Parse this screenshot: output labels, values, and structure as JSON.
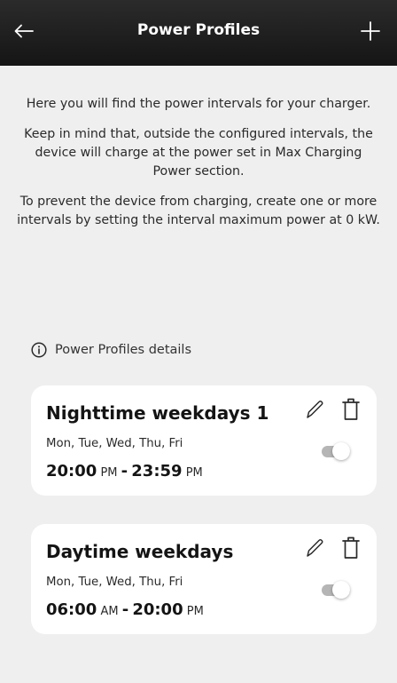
{
  "header": {
    "title": "Power Profiles",
    "back_icon": "arrow-left-icon",
    "add_icon": "plus-icon"
  },
  "intro": {
    "paragraphs": [
      "Here you will find the power intervals for your charger.",
      "Keep in mind that, outside the configured intervals, the device will charge at the power set in Max Charging Power section.",
      "To prevent the device from charging, create one or more intervals by setting the interval maximum power at 0 kW."
    ]
  },
  "details_link": {
    "label": "Power Profiles details",
    "icon": "info-icon"
  },
  "profiles": [
    {
      "name": "Nighttime weekdays 1",
      "days": "Mon, Tue, Wed, Thu, Fri",
      "start_time": "20:00",
      "start_period": "PM",
      "separator": "-",
      "end_time": "23:59",
      "end_period": "PM",
      "enabled": false
    },
    {
      "name": "Daytime weekdays",
      "days": "Mon, Tue, Wed, Thu, Fri",
      "start_time": "06:00",
      "start_period": "AM",
      "separator": "-",
      "end_time": "20:00",
      "end_period": "PM",
      "enabled": false
    }
  ],
  "colors": {
    "header_bg": "#1c1c1c",
    "page_bg": "#efefef",
    "card_bg": "#ffffff",
    "toggle_off": "#b5b5b5"
  }
}
